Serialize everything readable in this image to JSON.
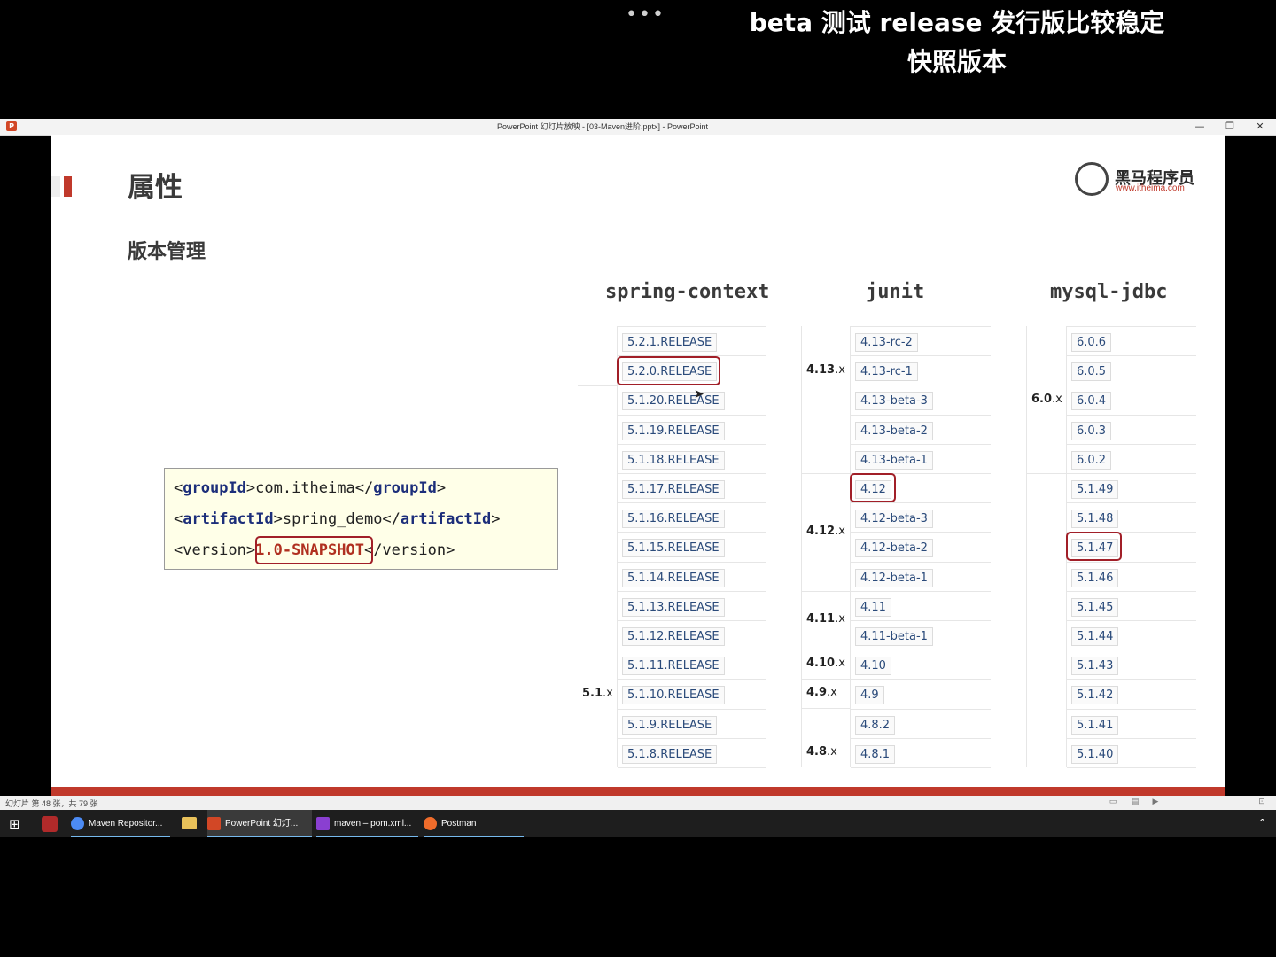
{
  "overlay": {
    "dots": "•••",
    "subtitle_line1": "beta 测试 release 发行版比较稳定",
    "subtitle_line2": "快照版本"
  },
  "window": {
    "title": "PowerPoint 幻灯片放映 - [03-Maven进阶.pptx] - PowerPoint",
    "app_icon": "P",
    "controls": [
      "—",
      "❐",
      "✕"
    ]
  },
  "slide": {
    "title": "属性",
    "subtitle": "版本管理",
    "logo_name": "黑马程序员",
    "logo_url": "www.itheima.com",
    "code": {
      "line1_open": "<",
      "line1_tag": "groupId",
      "line1_mid": ">com.itheima</",
      "line1_close": ">",
      "line2_open": "<",
      "line2_tag": "artifactId",
      "line2_mid": ">spring_demo</",
      "line2_close": ">",
      "line3_pre": "<version>",
      "line3_value": "1.0-SNAPSHOT",
      "line3_post": "</version>"
    },
    "spring": {
      "header": "spring-context",
      "versions": [
        "5.2.1.RELEASE",
        "5.2.0.RELEASE",
        "5.1.20.RELEASE",
        "5.1.19.RELEASE",
        "5.1.18.RELEASE",
        "5.1.17.RELEASE",
        "5.1.16.RELEASE",
        "5.1.15.RELEASE",
        "5.1.14.RELEASE",
        "5.1.13.RELEASE",
        "5.1.12.RELEASE",
        "5.1.11.RELEASE",
        "5.1.10.RELEASE",
        "5.1.9.RELEASE",
        "5.1.8.RELEASE"
      ],
      "group_num": "5.1",
      "group_x": ".x"
    },
    "junit": {
      "header": "junit",
      "versions": [
        "4.13-rc-2",
        "4.13-rc-1",
        "4.13-beta-3",
        "4.13-beta-2",
        "4.13-beta-1",
        "4.12",
        "4.12-beta-3",
        "4.12-beta-2",
        "4.12-beta-1",
        "4.11",
        "4.11-beta-1",
        "4.10",
        "4.9",
        "4.8.2",
        "4.8.1"
      ],
      "groups": [
        {
          "num": "4.13",
          "x": ".x"
        },
        {
          "num": "4.12",
          "x": ".x"
        },
        {
          "num": "4.11",
          "x": ".x"
        },
        {
          "num": "4.10",
          "x": ".x"
        },
        {
          "num": "4.9",
          "x": ".x"
        },
        {
          "num": "4.8",
          "x": ".x"
        }
      ]
    },
    "mysql": {
      "header": "mysql-jdbc",
      "versions": [
        "6.0.6",
        "6.0.5",
        "6.0.4",
        "6.0.3",
        "6.0.2",
        "5.1.49",
        "5.1.48",
        "5.1.47",
        "5.1.46",
        "5.1.45",
        "5.1.44",
        "5.1.43",
        "5.1.42",
        "5.1.41",
        "5.1.40"
      ],
      "group_num": "6.0",
      "group_x": ".x"
    }
  },
  "status": {
    "text": "幻灯片 第 48 张，共 79 张"
  },
  "taskbar": {
    "start": "⊞",
    "items": [
      "Maven Repositor...",
      "PowerPoint 幻灯...",
      "maven – pom.xml...",
      "Postman"
    ],
    "tray": "^"
  }
}
